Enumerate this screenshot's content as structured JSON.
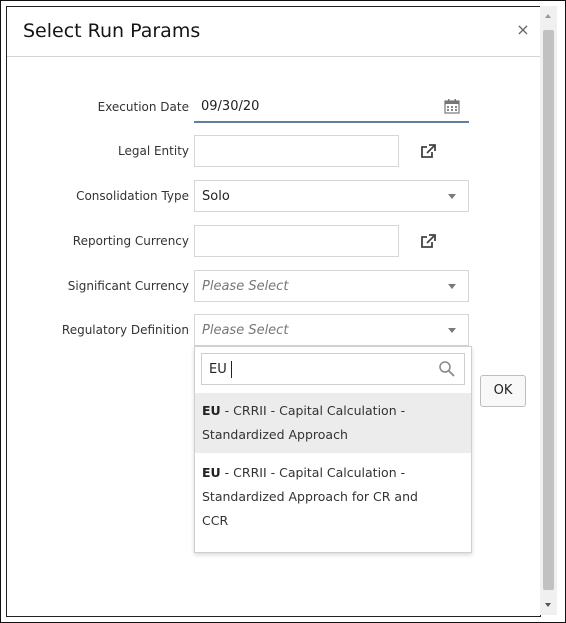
{
  "dialog": {
    "title": "Select Run Params",
    "close_symbol": "×"
  },
  "fields": {
    "execution_date": {
      "label": "Execution Date",
      "value": "09/30/20",
      "icon": "calendar-icon"
    },
    "legal_entity": {
      "label": "Legal Entity",
      "value": "",
      "icon": "external-link-icon"
    },
    "consolidation_type": {
      "label": "Consolidation Type",
      "value": "Solo"
    },
    "reporting_currency": {
      "label": "Reporting Currency",
      "value": "",
      "icon": "external-link-icon"
    },
    "significant_currency": {
      "label": "Significant Currency",
      "placeholder": "Please Select"
    },
    "regulatory_definition": {
      "label": "Regulatory Definition",
      "placeholder": "Please Select"
    }
  },
  "dropdown": {
    "search_value": "EU",
    "options": [
      {
        "prefix": "EU",
        "rest_line1": " - CRRII - Capital Calculation -",
        "line2": "Standardized Approach"
      },
      {
        "prefix": "EU",
        "rest_line1": " - CRRII - Capital Calculation -",
        "line2": "Standardized Approach for CR and",
        "line3": "CCR"
      }
    ]
  },
  "buttons": {
    "ok": "OK"
  },
  "colors": {
    "accent_underline": "#5f7fa5",
    "highlight": "#ececec"
  }
}
